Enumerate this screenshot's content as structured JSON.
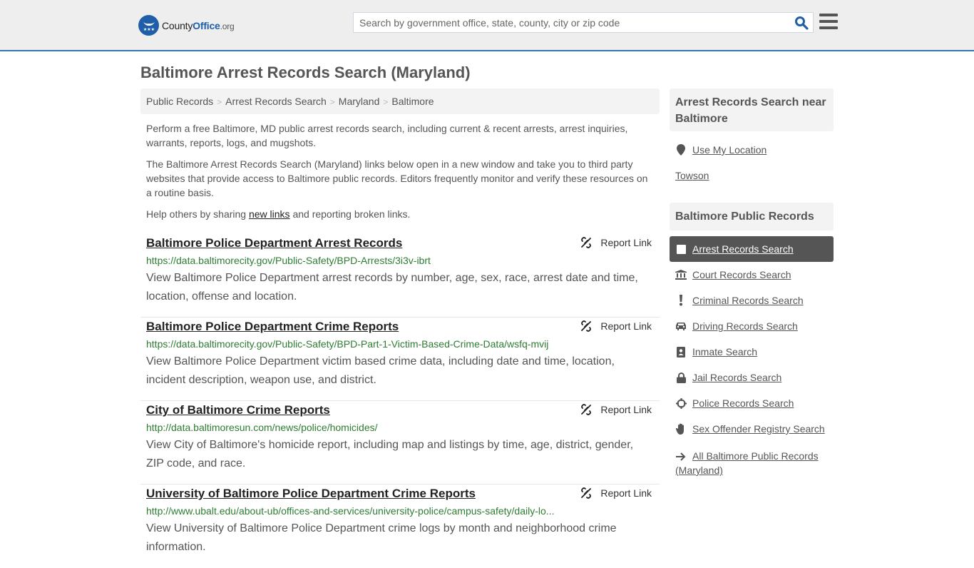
{
  "header": {
    "logo": {
      "county": "County",
      "office": "Office",
      "org": ".org"
    },
    "search_placeholder": "Search by government office, state, county, city or zip code",
    "accent_color": "#2f78b5"
  },
  "page_title": "Baltimore Arrest Records Search (Maryland)",
  "breadcrumb": [
    "Public Records",
    "Arrest Records Search",
    "Maryland",
    "Baltimore"
  ],
  "intro": {
    "p1": "Perform a free Baltimore, MD public arrest records search, including current & recent arrests, arrest inquiries, warrants, reports, logs, and mugshots.",
    "p2": "The Baltimore Arrest Records Search (Maryland) links below open in a new window and take you to third party websites that provide access to Baltimore public records. Editors frequently monitor and verify these resources on a routine basis.",
    "p3_before": "Help others by sharing ",
    "p3_link": "new links",
    "p3_after": " and reporting broken links."
  },
  "report_label": "Report Link",
  "results": [
    {
      "title": "Baltimore Police Department Arrest Records",
      "url": "https://data.baltimorecity.gov/Public-Safety/BPD-Arrests/3i3v-ibrt",
      "description": "View Baltimore Police Department arrest records by number, age, sex, race, arrest date and time, location, offense and location."
    },
    {
      "title": "Baltimore Police Department Crime Reports",
      "url": "https://data.baltimorecity.gov/Public-Safety/BPD-Part-1-Victim-Based-Crime-Data/wsfq-mvij",
      "description": "View Baltimore Police Department victim based crime data, including date and time, location, incident description, weapon use, and district."
    },
    {
      "title": "City of Baltimore Crime Reports",
      "url": "http://data.baltimoresun.com/news/police/homicides/",
      "description": "View City of Baltimore's homicide report, including map and listings by time, age, district, gender, ZIP code, and race."
    },
    {
      "title": "University of Baltimore Police Department Crime Reports",
      "url": "http://www.ubalt.edu/about-ub/offices-and-services/university-police/campus-safety/daily-lo...",
      "description": "View University of Baltimore Police Department crime logs by month and neighborhood crime information."
    }
  ],
  "sidebar": {
    "nearby_title": "Arrest Records Search near Baltimore",
    "use_location": "Use My Location",
    "nearby": [
      "Towson"
    ],
    "records_title": "Baltimore Public Records",
    "records": [
      {
        "label": "Arrest Records Search",
        "icon": "square-icon",
        "active": true
      },
      {
        "label": "Court Records Search",
        "icon": "courthouse-icon"
      },
      {
        "label": "Criminal Records Search",
        "icon": "exclamation-icon"
      },
      {
        "label": "Driving Records Search",
        "icon": "car-icon"
      },
      {
        "label": "Inmate Search",
        "icon": "id-badge-icon"
      },
      {
        "label": "Jail Records Search",
        "icon": "lock-icon"
      },
      {
        "label": "Police Records Search",
        "icon": "crosshairs-icon"
      },
      {
        "label": "Sex Offender Registry Search",
        "icon": "hand-icon"
      }
    ],
    "all_records": "All Baltimore Public Records (Maryland)"
  }
}
